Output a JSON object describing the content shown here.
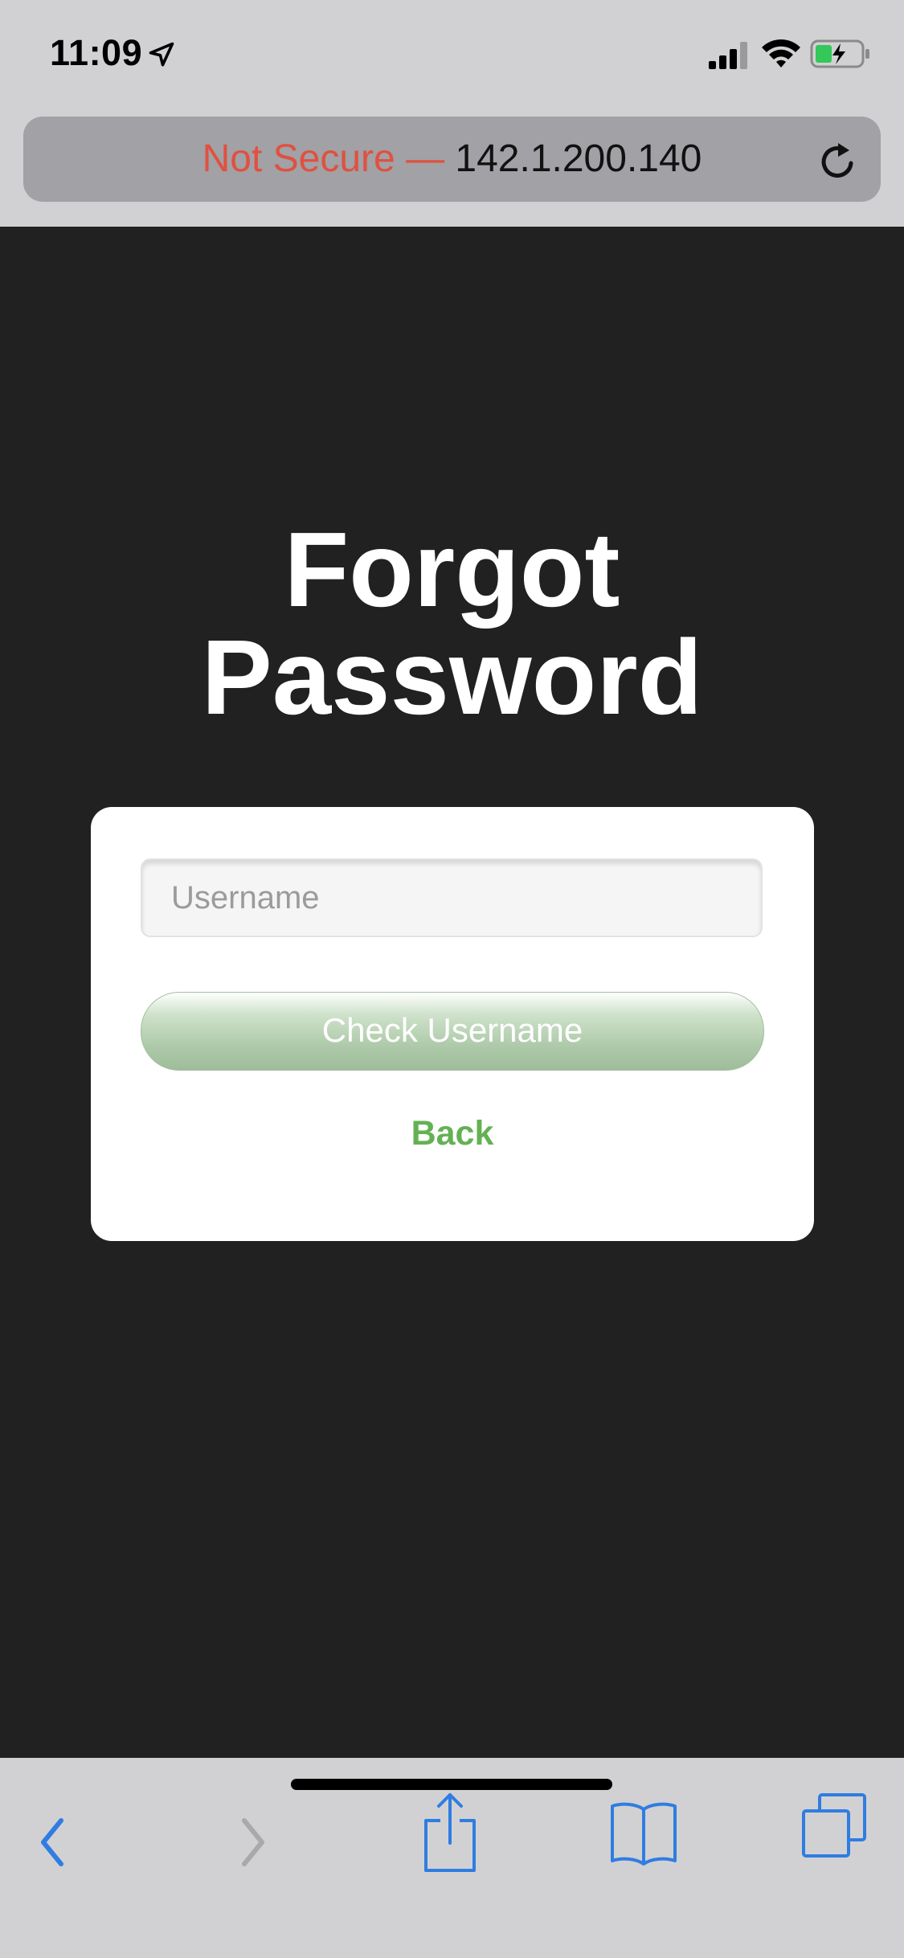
{
  "status_bar": {
    "time": "11:09",
    "icons": [
      "location-arrow-icon",
      "cellular-signal-icon",
      "wifi-icon",
      "battery-charging-icon"
    ]
  },
  "url_bar": {
    "security_label": "Not Secure —",
    "host": "142.1.200.140",
    "reload_icon": "reload-icon"
  },
  "page": {
    "title_line1": "Forgot",
    "title_line2": "Password",
    "username_placeholder": "Username",
    "username_value": "",
    "check_button_label": "Check Username",
    "back_link_label": "Back"
  },
  "toolbar": {
    "icons": [
      "chevron-left-icon",
      "chevron-right-icon",
      "share-icon",
      "bookmarks-icon",
      "tabs-icon"
    ]
  },
  "colors": {
    "page_background": "#212121",
    "chrome_background": "#d1d1d3",
    "insecure_text": "#e0513f",
    "accent_green": "#64b154",
    "button_green": "#adc9a9",
    "ios_blue": "#2f7de1"
  }
}
